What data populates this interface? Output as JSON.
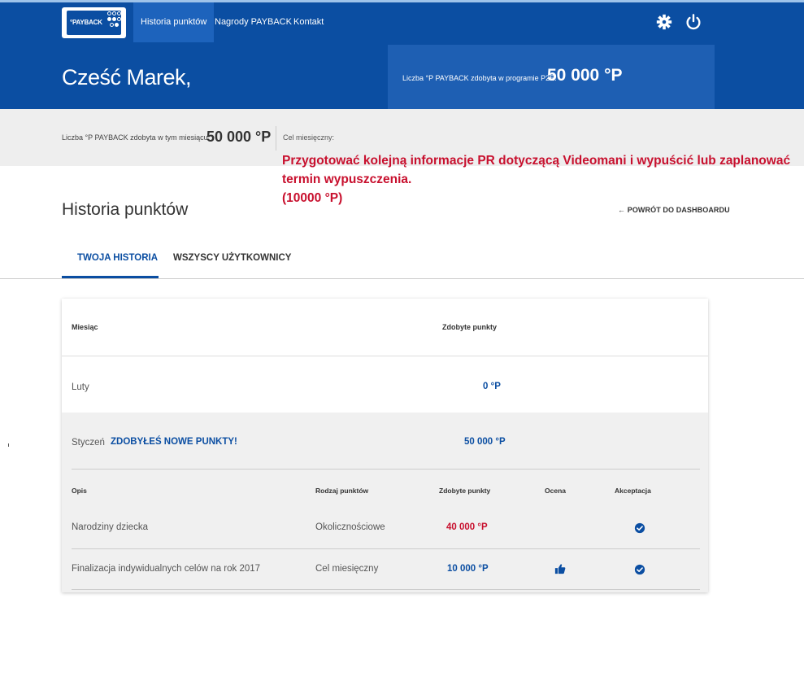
{
  "nav": {
    "logo_text": "°PAYBACK",
    "items": [
      {
        "label": "Historia punktów",
        "active": true
      },
      {
        "label": "Nagrody PAYBACK",
        "active": false
      },
      {
        "label": "Kontakt",
        "active": false
      }
    ],
    "icons": [
      "gear-icon",
      "power-icon"
    ]
  },
  "header": {
    "greeting": "Cześć Marek,",
    "p2e_label": "Liczba °P PAYBACK zdobyta w programie P2E:",
    "p2e_value": "50 000 °P"
  },
  "month_stats": {
    "label": "Liczba °P PAYBACK zdobyta w tym miesiącu:",
    "value": "50 000 °P",
    "goal_label": "Cel miesięczny:",
    "goal_line1": "Przygotować kolejną informacje PR dotyczącą Videomani i wypuścić lub zaplanować",
    "goal_line2": "termin wypuszczenia.",
    "goal_line3": "(10000 °P)"
  },
  "page": {
    "title": "Historia punktów",
    "back_link": "POWRÓT DO DASHBOARDU"
  },
  "tabs": [
    {
      "label": "TWOJA HISTORIA",
      "active": true
    },
    {
      "label": "WSZYSCY UŻYTKOWNICY",
      "active": false
    }
  ],
  "table": {
    "col_month": "Miesiąc",
    "col_points": "Zdobyte punkty",
    "rows": [
      {
        "month": "Luty",
        "points": "0 °P"
      },
      {
        "month": "Styczeń",
        "badge": "ZDOBYŁEŚ NOWE PUNKTY!",
        "points": "50 000 °P"
      }
    ],
    "sub_headers": {
      "desc": "Opis",
      "type": "Rodzaj punktów",
      "points": "Zdobyte punkty",
      "rating": "Ocena",
      "accept": "Akceptacja"
    },
    "sub_rows": [
      {
        "desc": "Narodziny dziecka",
        "type": "Okolicznościowe",
        "points": "40 000 °P",
        "rating": "",
        "accepted": true
      },
      {
        "desc": "Finalizacja indywidualnych celów na rok 2017",
        "type": "Cel miesięczny",
        "points": "10 000 °P",
        "rating": "thumbs-up-icon",
        "accepted": true
      }
    ]
  },
  "colors": {
    "brand_blue": "#0b4ea2",
    "accent_red": "#c8102e"
  }
}
